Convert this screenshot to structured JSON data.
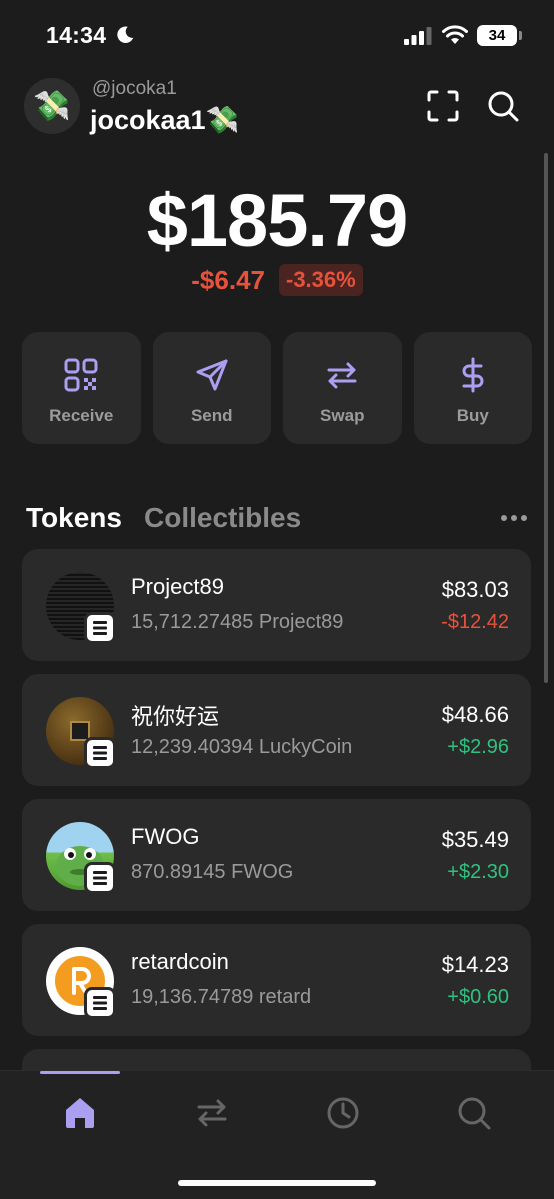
{
  "status_bar": {
    "time": "14:34",
    "battery": "34"
  },
  "header": {
    "handle": "@jocoka1",
    "username": "jocokaa1💸",
    "avatar_emoji": "💸"
  },
  "balance": {
    "total": "$185.79",
    "change_abs": "-$6.47",
    "change_pct": "-3.36%"
  },
  "actions": [
    {
      "label": "Receive",
      "icon": "qr-code-icon"
    },
    {
      "label": "Send",
      "icon": "send-icon"
    },
    {
      "label": "Swap",
      "icon": "swap-icon"
    },
    {
      "label": "Buy",
      "icon": "dollar-icon"
    }
  ],
  "tabs": {
    "active": "Tokens",
    "inactive": "Collectibles"
  },
  "tokens": [
    {
      "name": "Project89",
      "amount": "15,712.27485 Project89",
      "value": "$83.03",
      "change": "-$12.42",
      "direction": "negative"
    },
    {
      "name": "祝你好运",
      "amount": "12,239.40394 LuckyCoin",
      "value": "$48.66",
      "change": "+$2.96",
      "direction": "positive"
    },
    {
      "name": "FWOG",
      "amount": "870.89145 FWOG",
      "value": "$35.49",
      "change": "+$2.30",
      "direction": "positive"
    },
    {
      "name": "retardcoin",
      "amount": "19,136.74789 retard",
      "value": "$14.23",
      "change": "+$0.60",
      "direction": "positive"
    }
  ],
  "colors": {
    "accent": "#ab9ff2",
    "negative": "#e8523b",
    "positive": "#2ec27e",
    "background": "#1c1c1c",
    "card": "#2a2a2a"
  },
  "bottom_nav": [
    {
      "icon": "home-icon",
      "active": true
    },
    {
      "icon": "swap-icon",
      "active": false
    },
    {
      "icon": "history-icon",
      "active": false
    },
    {
      "icon": "search-icon",
      "active": false
    }
  ]
}
